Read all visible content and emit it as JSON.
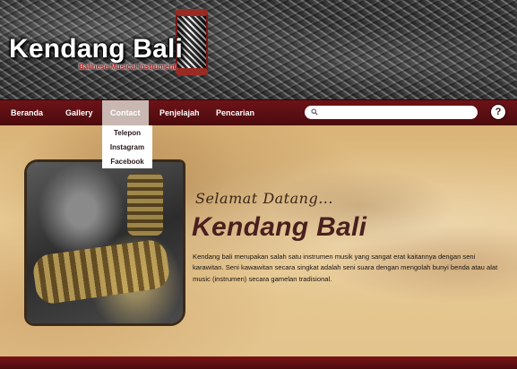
{
  "header": {
    "title": "Kendang Bali",
    "subtitle": "Balinese Musical Instrument"
  },
  "nav": {
    "items": [
      {
        "label": "Beranda"
      },
      {
        "label": "Gallery"
      },
      {
        "label": "Contact",
        "active": true
      },
      {
        "label": "Penjelajah"
      },
      {
        "label": "Pencarian"
      }
    ],
    "search_placeholder": "",
    "help_label": "?"
  },
  "dropdown": {
    "items": [
      "Telepon",
      "Instagram",
      "Facebook"
    ]
  },
  "main": {
    "welcome": "Selamat Datang...",
    "title": "Kendang Bali",
    "description": "Kendang bali merupakan salah satu instrumen musik yang sangat erat kaitannya dengan seni karawitan. Seni kawawitan secara singkat adalah seni suara dengan mengolah bunyi benda atau alat music (instrumen) secara gamelan tradisional."
  },
  "colors": {
    "nav_bg": "#5a0f12",
    "nav_active": "#c9b7b2",
    "title_color": "#4a1f1e",
    "subtitle_color": "#a11a1e"
  },
  "icons": {
    "search": "magnifier-icon",
    "help": "question-circle-icon"
  }
}
